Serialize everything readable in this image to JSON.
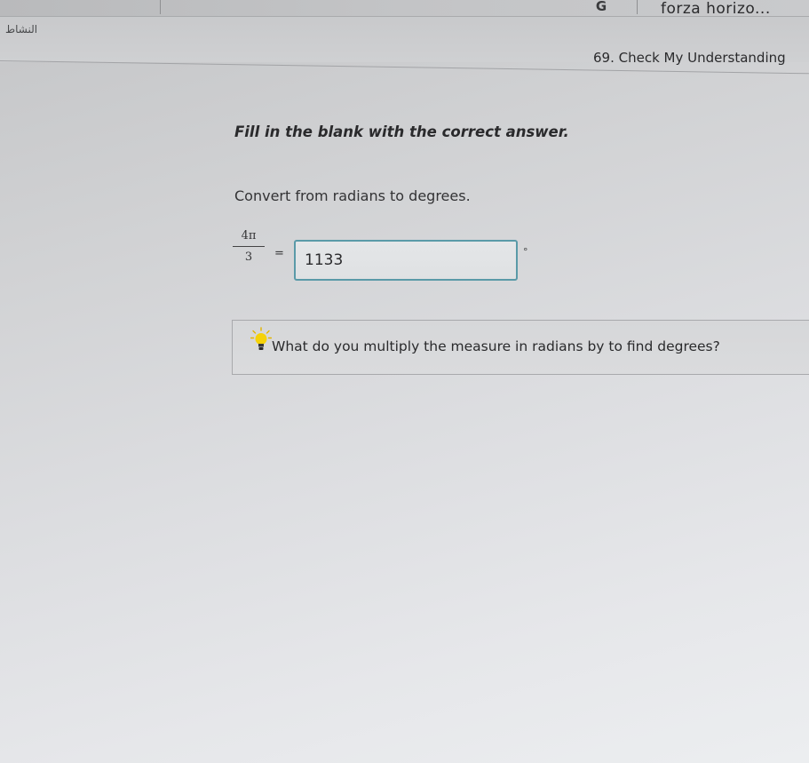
{
  "browser": {
    "tab_title": "forza horizo...",
    "tab_icon": "G"
  },
  "header": {
    "rtl_label": "النشاط",
    "section_title": "69. Check My Understanding"
  },
  "question": {
    "instruction": "Fill in the blank with the correct answer.",
    "prompt": "Convert from radians to degrees.",
    "fraction_numerator": "4π",
    "fraction_denominator": "3",
    "equals_sign": "=",
    "answer_value": "1133",
    "degree_symbol": "°"
  },
  "hint": {
    "text": "What do you multiply the measure in radians by to find degrees?",
    "icon": "lightbulb-icon"
  },
  "colors": {
    "answer_border": "#5a9aa8",
    "hint_bulb": "#f5d20a"
  }
}
